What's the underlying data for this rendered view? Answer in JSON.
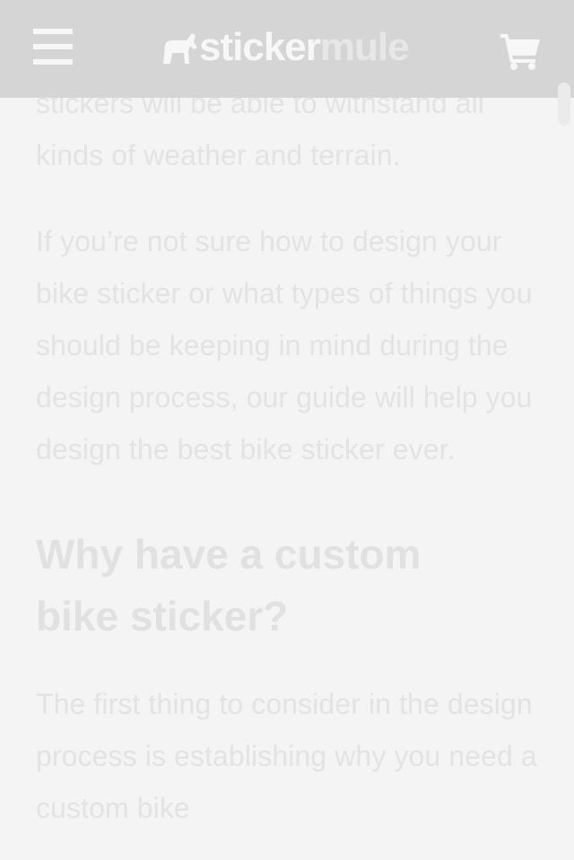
{
  "header": {
    "menu_icon": "hamburger-menu-icon",
    "logo": {
      "brand_part1": "sticker",
      "brand_part2": "mule",
      "mark_icon": "mule-logo-icon"
    },
    "cart_icon": "shopping-cart-icon"
  },
  "article": {
    "paragraph_partial": "stickers will be able to withstand all kinds of weather and terrain.",
    "paragraph_design": "If you’re not sure how to design your bike sticker or what types of things you should be keeping in mind during the design process, our guide will help you design the best bike sticker ever.",
    "heading": "Why have a custom bike sticker?",
    "paragraph_next": "The first thing to consider in the design process is establishing why you need a custom bike"
  },
  "colors": {
    "header_bg": "#d5d5d5",
    "page_bg": "#f4f4f4",
    "text": "#e3e3e3"
  }
}
